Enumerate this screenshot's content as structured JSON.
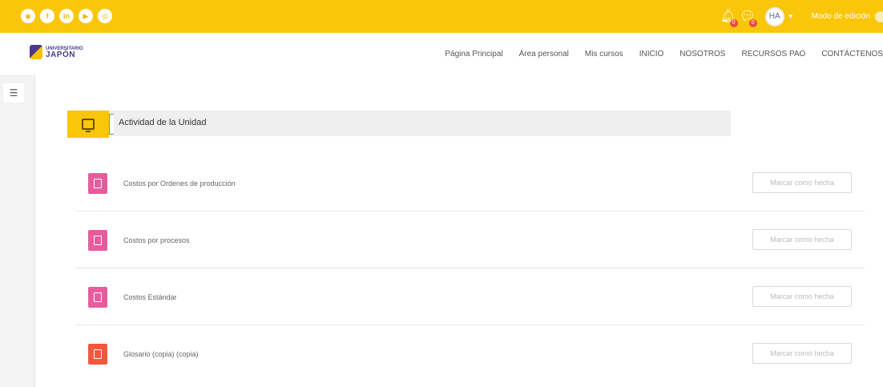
{
  "social": {
    "icons": [
      {
        "name": "globe-icon",
        "glyph": "◉"
      },
      {
        "name": "facebook-icon",
        "glyph": "f"
      },
      {
        "name": "linkedin-icon",
        "glyph": "in"
      },
      {
        "name": "youtube-icon",
        "glyph": "▶"
      },
      {
        "name": "instagram-icon",
        "glyph": "◎"
      }
    ]
  },
  "header": {
    "notifications_badge": "0",
    "messages_badge": "0",
    "avatar_initials": "HA",
    "edit_mode_label": "Modo de edición"
  },
  "nav": {
    "logo_small": "UNIVERSITARIO",
    "logo_main": "JAPÓN",
    "items": [
      "Página Principal",
      "Área personal",
      "Mis cursos",
      "INICIO",
      "NOSOTROS",
      "RECURSOS PAO",
      "CONTÁCTENOS"
    ]
  },
  "section": {
    "title": "Actividad de la Unidad"
  },
  "activities": [
    {
      "name": "Costos por Ordenes de producción",
      "button": "Marcar como hecha",
      "color": "#e85c9d"
    },
    {
      "name": "Costos por procesos",
      "button": "Marcar como hecha",
      "color": "#e85c9d"
    },
    {
      "name": "Costos Estándar",
      "button": "Marcar como hecha",
      "color": "#e85c9d"
    },
    {
      "name": "Glosario (copia) (copia)",
      "button": "Marcar como hecha",
      "color": "#f0593e"
    }
  ],
  "colors": {
    "brand_yellow": "#f9c60a",
    "resource_pink": "#e85c9d",
    "glossary_orange": "#f0593e"
  }
}
